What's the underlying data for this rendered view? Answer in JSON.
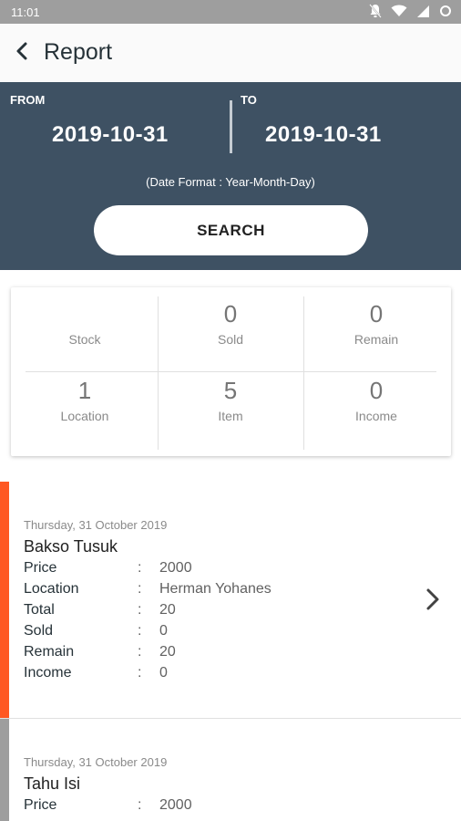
{
  "statusbar": {
    "time": "11:01"
  },
  "header": {
    "title": "Report"
  },
  "date_panel": {
    "from_label": "FROM",
    "from_date": "2019-10-31",
    "to_label": "TO",
    "to_date": "2019-10-31",
    "format_hint": "(Date Format : Year-Month-Day)",
    "search_label": "SEARCH"
  },
  "stats": [
    {
      "value": "",
      "label": "Stock"
    },
    {
      "value": "0",
      "label": "Sold"
    },
    {
      "value": "0",
      "label": "Remain"
    },
    {
      "value": "1",
      "label": "Location"
    },
    {
      "value": "5",
      "label": "Item"
    },
    {
      "value": "0",
      "label": "Income"
    }
  ],
  "reports": [
    {
      "date": "Thursday, 31 October 2019",
      "name": "Bakso Tusuk",
      "accent": "#ff5722",
      "fields": [
        {
          "key": "Price",
          "value": "2000"
        },
        {
          "key": "Location",
          "value": "Herman Yohanes"
        },
        {
          "key": "Total",
          "value": "20"
        },
        {
          "key": "Sold",
          "value": "0"
        },
        {
          "key": "Remain",
          "value": "20"
        },
        {
          "key": "Income",
          "value": "0"
        }
      ]
    },
    {
      "date": "Thursday, 31 October 2019",
      "name": "Tahu Isi",
      "accent": "#9e9e9e",
      "fields": [
        {
          "key": "Price",
          "value": "2000"
        }
      ]
    }
  ],
  "colors": {
    "panel": "#3e5163",
    "accent_orange": "#ff5722",
    "accent_gray": "#9e9e9e"
  },
  "icons": [
    "back-arrow-icon",
    "chevron-right-icon",
    "mute-icon",
    "wifi-icon",
    "signal-icon",
    "battery-icon"
  ]
}
